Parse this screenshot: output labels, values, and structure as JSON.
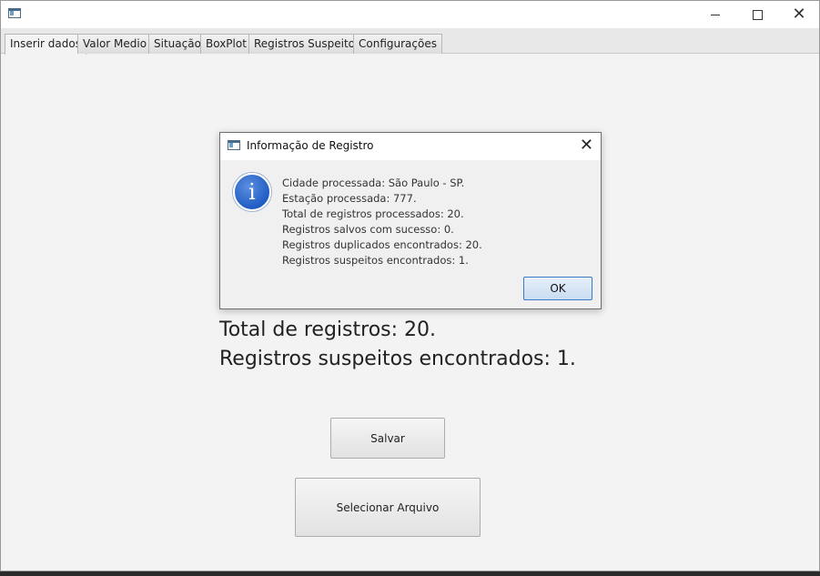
{
  "window": {
    "controls": {
      "minimize_icon": "minimize-icon",
      "maximize_icon": "maximize-icon",
      "close_glyph": "✕"
    }
  },
  "tabs": [
    {
      "label": "Inserir dados",
      "active": true
    },
    {
      "label": "Valor Medio",
      "active": false
    },
    {
      "label": "Situação",
      "active": false
    },
    {
      "label": "BoxPlot",
      "active": false
    },
    {
      "label": "Registros Suspeitos",
      "active": false
    },
    {
      "label": "Configurações",
      "active": false
    }
  ],
  "main": {
    "total_registros": "Total de registros: 20.",
    "suspeitos": "Registros suspeitos encontrados: 1.",
    "salvar_label": "Salvar",
    "selecionar_label": "Selecionar Arquivo"
  },
  "dialog": {
    "title": "Informação de Registro",
    "close_glyph": "✕",
    "info_glyph": "i",
    "lines": [
      "Cidade processada: São Paulo - SP.",
      "Estação processada: 777.",
      "Total de registros processados: 20.",
      "Registros salvos com sucesso: 0.",
      "Registros duplicados encontrados: 20.",
      "Registros suspeitos encontrados: 1."
    ],
    "ok_label": "OK"
  },
  "colors": {
    "accent": "#3a7ac6",
    "info_icon": "#1f5cc4",
    "window_bg": "#f3f3f3"
  }
}
